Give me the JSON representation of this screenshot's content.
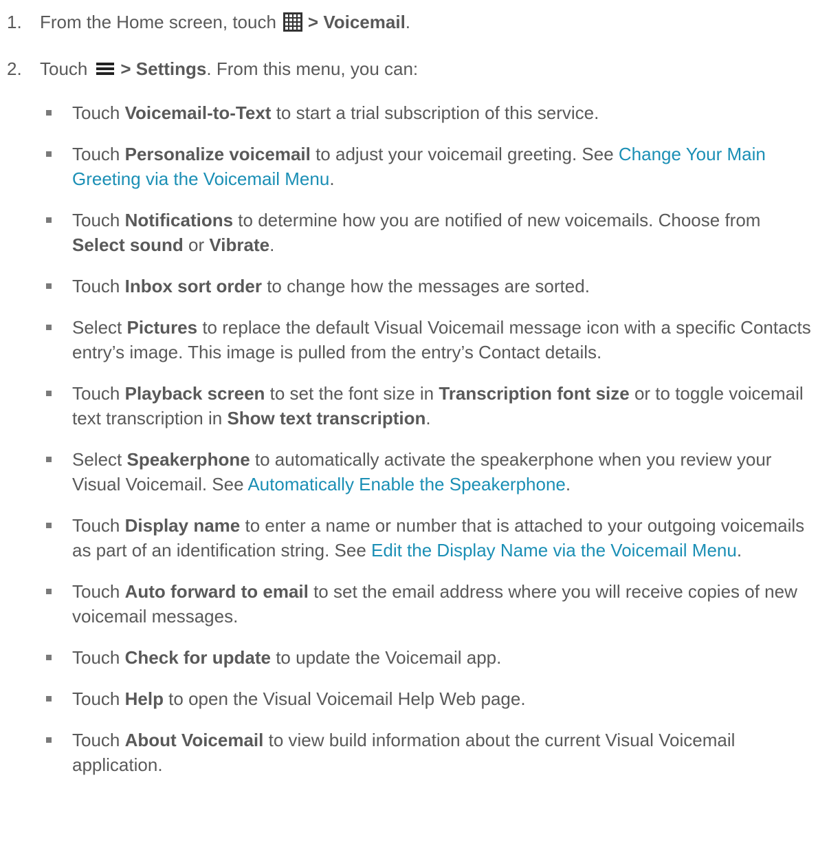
{
  "steps": [
    {
      "num": "1.",
      "pre": "From the Home screen, touch",
      "icon": "apps-grid-icon",
      "bold": "> Voicemail",
      "post": "."
    },
    {
      "num": "2.",
      "pre": "Touch",
      "icon": "menu-icon",
      "bold": "> Settings",
      "post": ". From this menu, you can:"
    }
  ],
  "bullets": [
    {
      "parts": [
        {
          "t": "Touch "
        },
        {
          "t": "Voicemail-to-Text",
          "b": true
        },
        {
          "t": " to start a trial subscription of this service."
        }
      ]
    },
    {
      "parts": [
        {
          "t": "Touch "
        },
        {
          "t": "Personalize voicemail",
          "b": true
        },
        {
          "t": " to adjust your voicemail greeting. See "
        },
        {
          "t": "Change Your Main Greeting via the Voicemail Menu",
          "link": true
        },
        {
          "t": "."
        }
      ]
    },
    {
      "parts": [
        {
          "t": "Touch "
        },
        {
          "t": "Notifications",
          "b": true
        },
        {
          "t": " to determine how you are notified of new voicemails. Choose from "
        },
        {
          "t": "Select sound",
          "b": true
        },
        {
          "t": " or "
        },
        {
          "t": "Vibrate",
          "b": true
        },
        {
          "t": "."
        }
      ]
    },
    {
      "parts": [
        {
          "t": "Touch "
        },
        {
          "t": "Inbox sort order",
          "b": true
        },
        {
          "t": " to change how the messages are sorted."
        }
      ]
    },
    {
      "parts": [
        {
          "t": "Select "
        },
        {
          "t": "Pictures",
          "b": true
        },
        {
          "t": " to replace the default Visual Voicemail message icon with a specific Contacts entry’s image. This image is pulled from the entry’s Contact details."
        }
      ]
    },
    {
      "parts": [
        {
          "t": "Touch "
        },
        {
          "t": "Playback screen",
          "b": true
        },
        {
          "t": " to set the font size in "
        },
        {
          "t": "Transcription font size",
          "b": true
        },
        {
          "t": " or to toggle voicemail text transcription in "
        },
        {
          "t": "Show text transcription",
          "b": true
        },
        {
          "t": "."
        }
      ]
    },
    {
      "parts": [
        {
          "t": "Select "
        },
        {
          "t": "Speakerphone",
          "b": true
        },
        {
          "t": " to automatically activate the speakerphone when you review your Visual Voicemail. See "
        },
        {
          "t": "Automatically Enable the Speakerphone",
          "link": true
        },
        {
          "t": "."
        }
      ]
    },
    {
      "parts": [
        {
          "t": "Touch "
        },
        {
          "t": "Display name",
          "b": true
        },
        {
          "t": " to enter a name or number that is attached to your outgoing voicemails as part of an identification string. See "
        },
        {
          "t": "Edit the Display Name via the Voicemail Menu",
          "link": true
        },
        {
          "t": "."
        }
      ]
    },
    {
      "parts": [
        {
          "t": "Touch "
        },
        {
          "t": "Auto forward to email",
          "b": true
        },
        {
          "t": " to set the email address where you will receive copies of new voicemail messages."
        }
      ]
    },
    {
      "parts": [
        {
          "t": "Touch "
        },
        {
          "t": "Check for update",
          "b": true
        },
        {
          "t": " to update the Voicemail app."
        }
      ]
    },
    {
      "parts": [
        {
          "t": "Touch "
        },
        {
          "t": "Help",
          "b": true
        },
        {
          "t": " to open the Visual Voicemail Help Web page."
        }
      ]
    },
    {
      "parts": [
        {
          "t": "Touch "
        },
        {
          "t": "About Voicemail",
          "b": true
        },
        {
          "t": " to view build information about the current Visual Voicemail application."
        }
      ]
    }
  ]
}
